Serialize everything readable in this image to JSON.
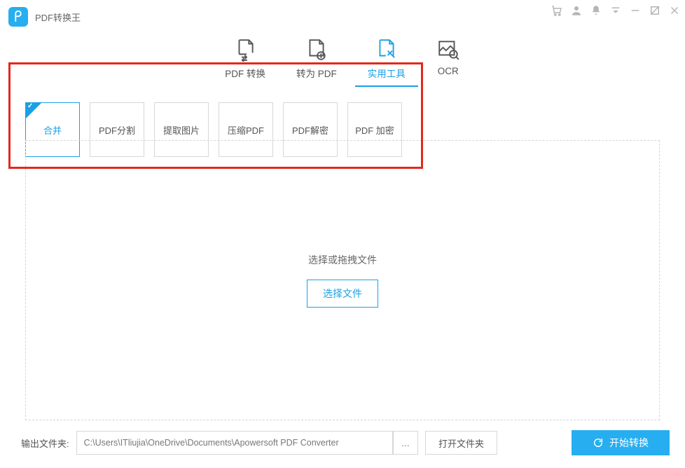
{
  "app": {
    "title": "PDF转换王"
  },
  "tabs": [
    {
      "label": "PDF 转换"
    },
    {
      "label": "转为 PDF"
    },
    {
      "label": "实用工具",
      "active": true
    },
    {
      "label": "OCR"
    }
  ],
  "tools": [
    {
      "label": "合并",
      "selected": true
    },
    {
      "label": "PDF分割"
    },
    {
      "label": "提取图片"
    },
    {
      "label": "压缩PDF"
    },
    {
      "label": "PDF解密"
    },
    {
      "label": "PDF 加密"
    }
  ],
  "drop": {
    "text": "选择或拖拽文件",
    "button": "选择文件"
  },
  "bottom": {
    "label": "输出文件夹:",
    "path": "C:\\Users\\ITliujia\\OneDrive\\Documents\\Apowersoft PDF Converter",
    "browse": "...",
    "open_folder": "打开文件夹",
    "start": "开始转换"
  },
  "colors": {
    "accent": "#27aef0",
    "highlight": "#e3281c"
  }
}
